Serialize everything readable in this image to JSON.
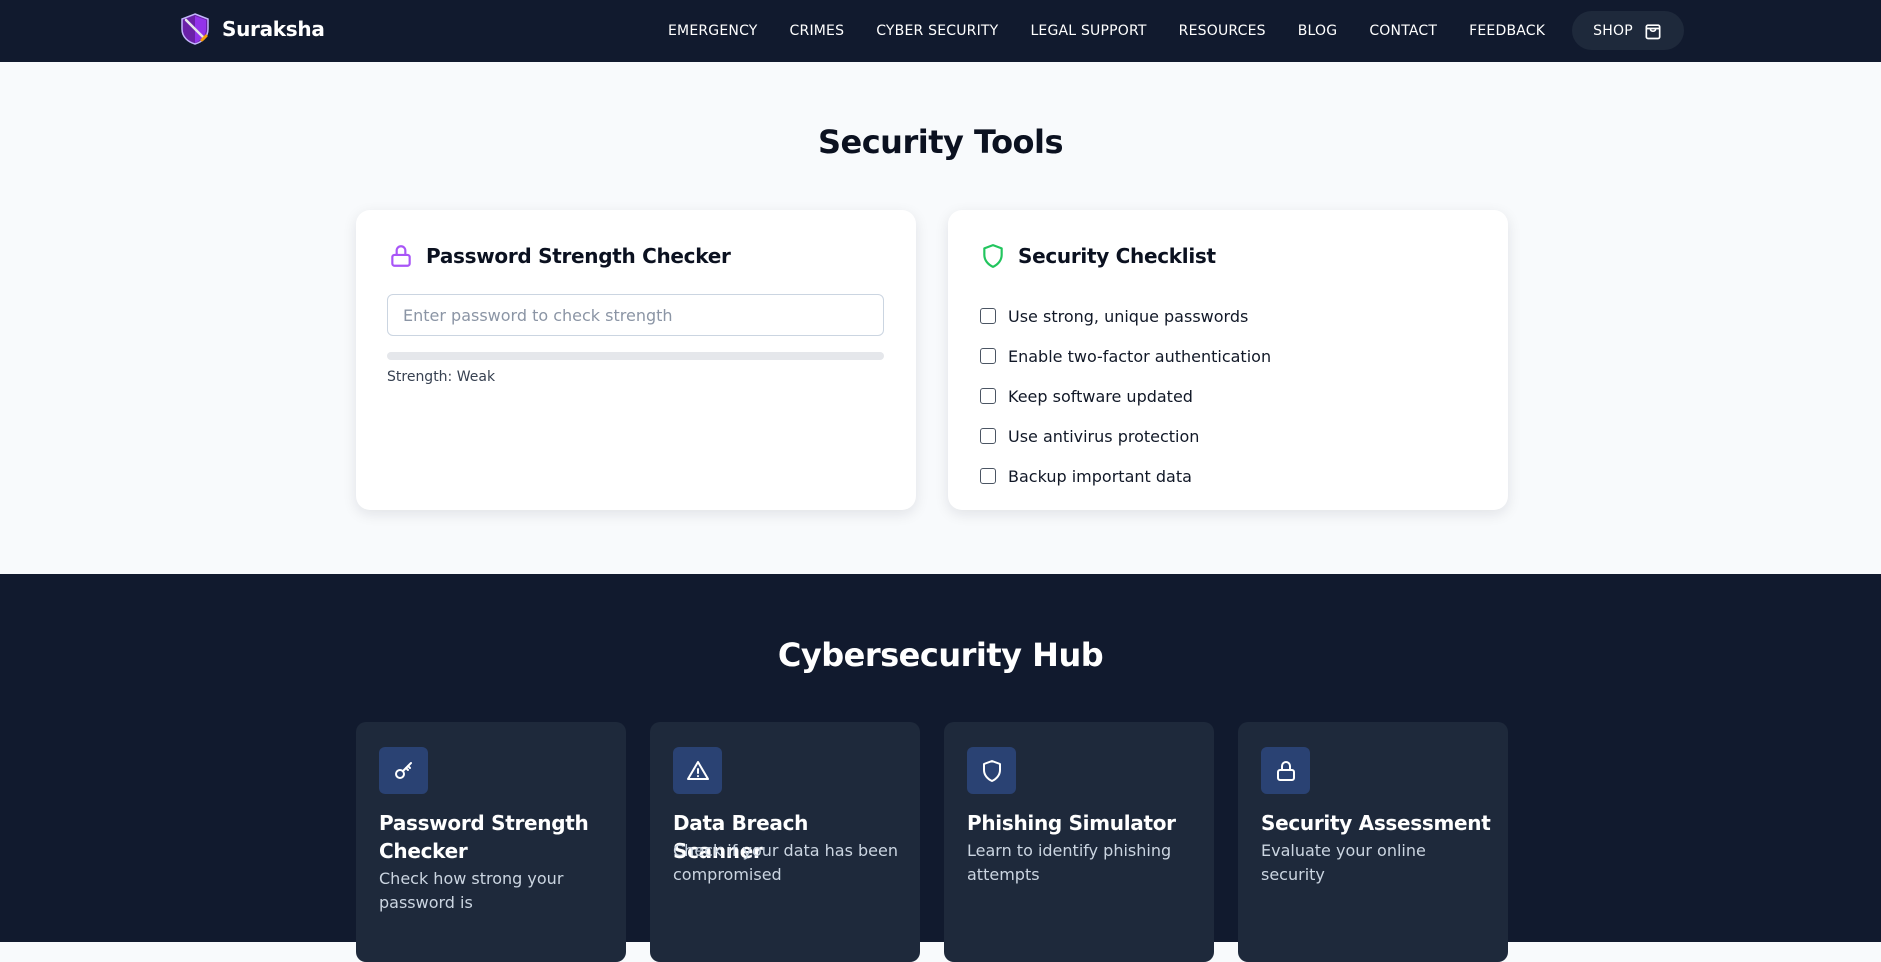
{
  "nav": {
    "brand": "Suraksha",
    "logo_icon": "shield-sword-icon",
    "links": [
      "EMERGENCY",
      "CRIMES",
      "CYBER SECURITY",
      "LEGAL SUPPORT",
      "RESOURCES",
      "BLOG",
      "CONTACT",
      "FEEDBACK"
    ],
    "shop_label": "SHOP",
    "shop_icon": "shopping-bag-icon"
  },
  "tools": {
    "title": "Security Tools",
    "password_checker": {
      "title": "Password Strength Checker",
      "icon": "lock-icon",
      "icon_color": "#a855f7",
      "placeholder": "Enter password to check strength",
      "value": "",
      "strength_text": "Strength: Weak",
      "strength_fraction": 0
    },
    "checklist": {
      "title": "Security Checklist",
      "icon": "shield-icon",
      "icon_color": "#22c55e",
      "items": [
        {
          "label": "Use strong, unique passwords",
          "checked": false
        },
        {
          "label": "Enable two-factor authentication",
          "checked": false
        },
        {
          "label": "Keep software updated",
          "checked": false
        },
        {
          "label": "Use antivirus protection",
          "checked": false
        },
        {
          "label": "Backup important data",
          "checked": false
        }
      ]
    }
  },
  "hub": {
    "title": "Cybersecurity Hub",
    "cards": [
      {
        "title": "Password Strength Checker",
        "desc": "Check how strong your password is",
        "icon": "key-icon"
      },
      {
        "title": "Data Breach Scanner",
        "desc": "Check if your data has been compromised",
        "icon": "warning-triangle-icon"
      },
      {
        "title": "Phishing Simulator",
        "desc": "Learn to identify phishing attempts",
        "icon": "shield-icon"
      },
      {
        "title": "Security Assessment",
        "desc": "Evaluate your online security",
        "icon": "lock-icon"
      }
    ]
  },
  "colors": {
    "nav_bg": "#111a2e",
    "page_bg": "#f8fafc",
    "card_dark": "#1e293b",
    "icon_tile": "#2a4273"
  }
}
